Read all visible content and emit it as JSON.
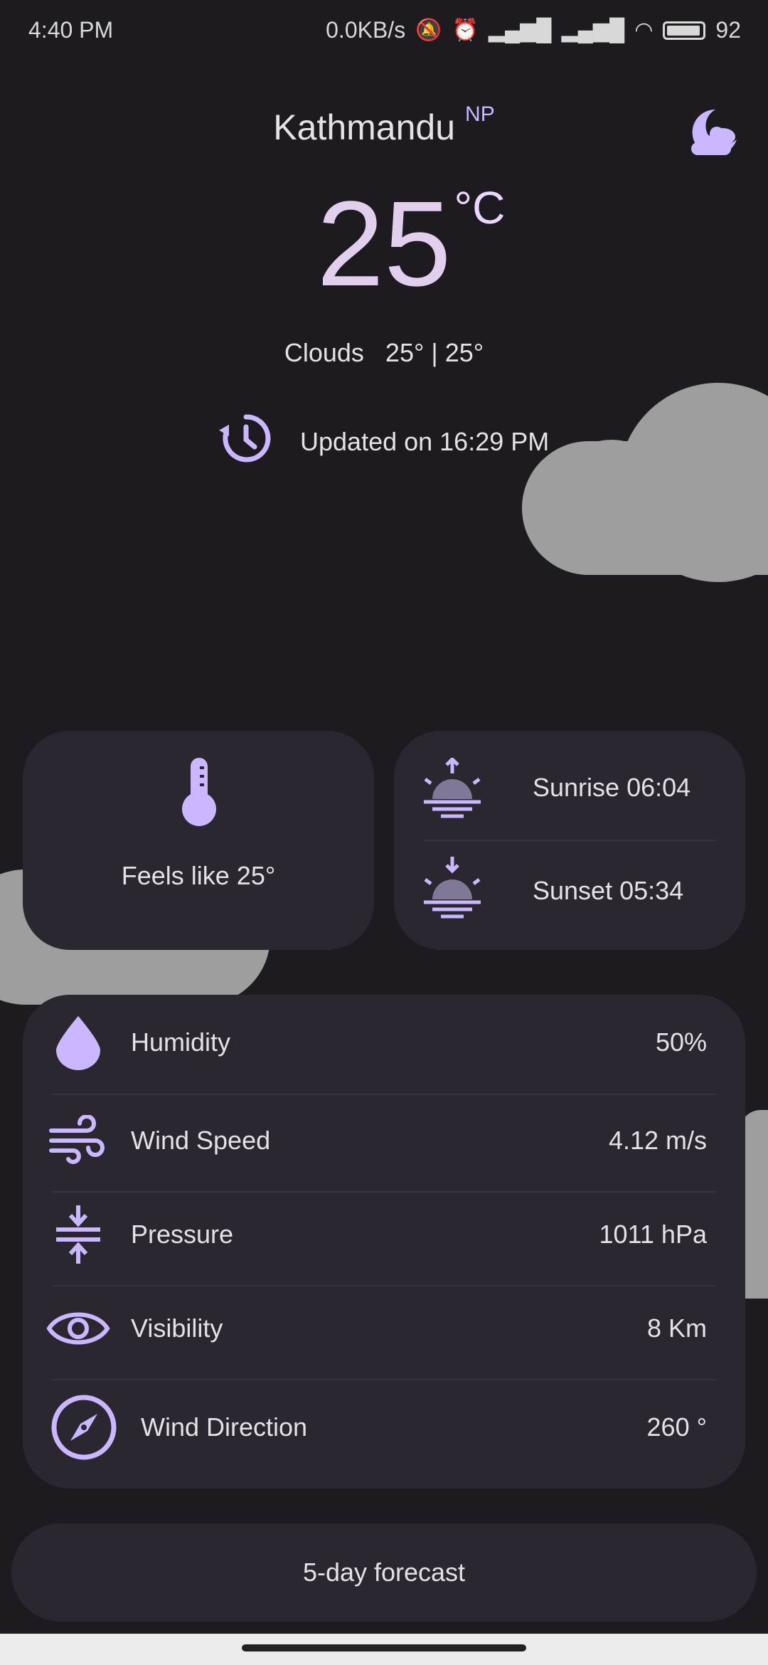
{
  "status_bar": {
    "time": "4:40 PM",
    "net_speed": "0.0KB/s",
    "battery": "92"
  },
  "header": {
    "city": "Kathmandu",
    "country_code": "NP",
    "night_mode_icon": "moon-cloud-icon"
  },
  "current": {
    "temperature": "25",
    "unit": "°C",
    "condition": "Clouds",
    "temp_range": "25° | 25°",
    "updated_text": "Updated on 16:29 PM"
  },
  "feels_like": {
    "label": "Feels like 25°"
  },
  "sun": {
    "sunrise": "Sunrise 06:04",
    "sunset": "Sunset 05:34"
  },
  "details": {
    "humidity_label": "Humidity",
    "humidity_value": "50%",
    "wind_speed_label": "Wind Speed",
    "wind_speed_value": "4.12 m/s",
    "pressure_label": "Pressure",
    "pressure_value": "1011 hPa",
    "visibility_label": "Visibility",
    "visibility_value": "8 Km",
    "wind_direction_label": "Wind Direction",
    "wind_direction_value": "260 °"
  },
  "forecast_button": "5-day forecast",
  "colors": {
    "background": "#1d1b20",
    "card": "#2a2731",
    "accent": "#cbb7ff",
    "cloud": "#9e9e9e"
  }
}
